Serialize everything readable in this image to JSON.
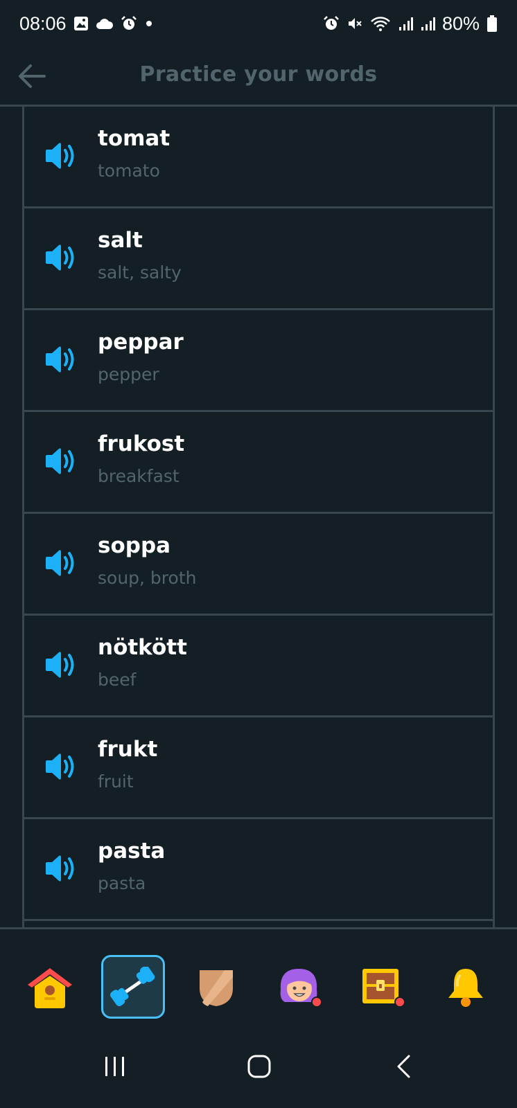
{
  "status": {
    "time": "08:06",
    "battery": "80%",
    "icons_left": [
      "gallery-icon",
      "cloud-icon",
      "alarm-icon",
      "dot-icon"
    ],
    "icons_right": [
      "alarm-icon",
      "mute-icon",
      "wifi-icon",
      "signal-icon",
      "signal-icon",
      "battery-icon"
    ]
  },
  "header": {
    "title": "Practice your words",
    "back_icon": "back-arrow-icon"
  },
  "words": [
    {
      "word": "tomat",
      "translation": "tomato"
    },
    {
      "word": "salt",
      "translation": "salt, salty"
    },
    {
      "word": "peppar",
      "translation": "pepper"
    },
    {
      "word": "frukost",
      "translation": "breakfast"
    },
    {
      "word": "soppa",
      "translation": "soup, broth"
    },
    {
      "word": "nötkött",
      "translation": "beef"
    },
    {
      "word": "frukt",
      "translation": "fruit"
    },
    {
      "word": "pasta",
      "translation": "pasta"
    }
  ],
  "tabs": [
    {
      "name": "home",
      "icon": "home-icon",
      "active": false
    },
    {
      "name": "practice",
      "icon": "dumbbell-icon",
      "active": true
    },
    {
      "name": "leagues",
      "icon": "shield-icon",
      "active": false
    },
    {
      "name": "profile",
      "icon": "avatar-icon",
      "active": false
    },
    {
      "name": "shop",
      "icon": "treasure-chest-icon",
      "active": false
    },
    {
      "name": "notifications",
      "icon": "bell-icon",
      "active": false
    }
  ],
  "colors": {
    "background": "#131f24",
    "divider": "#37464f",
    "muted_text": "#52656d",
    "accent": "#1cb0f6"
  }
}
